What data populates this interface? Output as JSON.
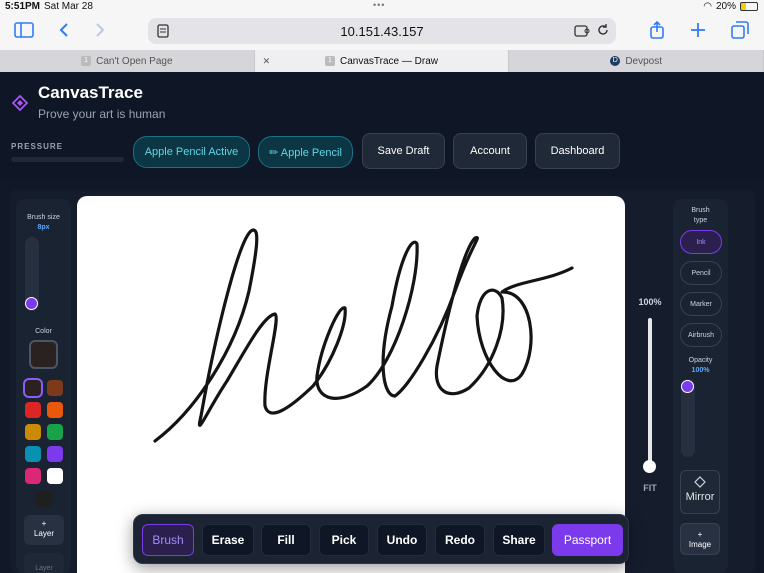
{
  "status_bar": {
    "time": "5:51PM",
    "date": "Sat Mar 28",
    "battery": "20%"
  },
  "browser": {
    "url": "10.151.43.157",
    "tabs": [
      {
        "label": "Can't Open Page",
        "favicon": "1"
      },
      {
        "label": "CanvasTrace — Draw",
        "favicon": "1"
      },
      {
        "label": "Devpost",
        "favicon": "D"
      }
    ]
  },
  "app": {
    "title": "CanvasTrace",
    "subtitle": "Prove your art is human",
    "pressure_label": "PRESSURE",
    "header_buttons": {
      "pencil_active": "Apple Pencil Active",
      "pencil": "✏ Apple Pencil",
      "save_draft": "Save Draft",
      "account": "Account",
      "dashboard": "Dashboard"
    }
  },
  "left_panel": {
    "brush_size_label": "Brush size",
    "brush_size_value": "8px",
    "color_label": "Color",
    "current_color": "#2a2220",
    "palette": [
      "#2a2220",
      "#7c3a1a",
      "#dc2626",
      "#ea580c",
      "#ca8a04",
      "#16a34a",
      "#0891b2",
      "#7c3aed",
      "#db2777",
      "#ffffff",
      "#1f1f1f"
    ],
    "layer_button": "+\nLayer",
    "layer_button_2": "Layer"
  },
  "zoom": {
    "label": "100%",
    "fit": "FIT"
  },
  "right_panel": {
    "brush_type_label": "Brush\ntype",
    "brush_types": [
      "Ink",
      "Pencil",
      "Marker",
      "Airbrush"
    ],
    "opacity_label": "Opacity",
    "opacity_value": "100%",
    "mirror": "Mirror",
    "image_button": "+\nImage"
  },
  "tools": {
    "brush": "Brush",
    "erase": "Erase",
    "fill": "Fill",
    "pick": "Pick",
    "undo": "Undo",
    "redo": "Redo",
    "share": "Share",
    "passport": "Passport"
  },
  "colors": {
    "accent": "#7c3aed",
    "teal": "#5fd6e8",
    "stroke": "#141414"
  }
}
